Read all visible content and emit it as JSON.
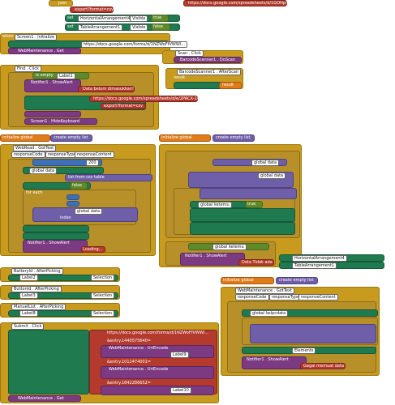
{
  "labels": {
    "json": "json",
    "url_top": "https://docs.google.com/spreadsheets/d/1GOHp/gv...",
    "export_format": "export?format=csv",
    "set": "set",
    "to": "to",
    "when": "when",
    "do": "do",
    "call": "call",
    "if": "if",
    "then": "then",
    "else": "else",
    "result": "result",
    "notice": "notice",
    "text": "text",
    "get": "get",
    "initialize_global": "initialize global",
    "create_empty_list": "create empty list",
    "for_each": "for each",
    "from": "from",
    "by": "by",
    "index": "index",
    "true": "true",
    "false": "false",
    "visible": "Visible",
    "responseCode": "responseCode",
    "responseType": "responseType",
    "responseContent": "responseContent",
    "list_item": "list item",
    "number": "number"
  },
  "blocks": {
    "set_horizontal1": "HorizontalArrangement4",
    "set_table1": "TableArrangement1",
    "screen_init": "Screen1 . Initialize",
    "web_url_1": "https://docs.google.com/forms/d/1NZWoFfVWWl...",
    "web_get": "WebMaintenance . Get",
    "scan_click": "Scan . Click",
    "barcode_do_scan": "BarcodeScanner1 . DoScan",
    "find_click": "Find . Click",
    "is_empty": "is empty",
    "label1": "Label1",
    "notifier_show_alert": "Notifier1 . ShowAlert",
    "data_belum": "Data belum dimasukkan!",
    "barcode_after_scan": "BarcodeScanner1 . AfterScan",
    "url_2": "https://docs.google.com/spreadsheets/d/e/2PACX-1vRk...",
    "export_format_csv": "export?format=csv",
    "get_result": "result",
    "screen_hide_keyboard": "Screen1 . HideKeyboard",
    "init_global_data": "data",
    "web_got_text": "WebRead . GotText",
    "code_200": "200",
    "init_global_ketemu": "ketemu",
    "list_from_csv": "list from csv table",
    "global_data": "global data",
    "loading": "Loading...",
    "ketemu_label": "global ketemu",
    "data_tidak_ada": "Data Tidak ada",
    "init_global_kelpcdata": "kelpcdata",
    "web_got_text_2": "WebMaintenance . GotText",
    "elements": "Elements",
    "global_kelpcdata": "global kelpcdata",
    "gagal_memuat": "Gagal memuat data",
    "batteryid_after_picking": "BatteryId . AfterPicking",
    "buttonid_after_picking": "ButtonId . AfterPicking",
    "manuelist_after_picking": "ManuelList . AfterPicking",
    "submit_click": "Submit . Click",
    "url_submit": "https://docs.google.com/forms/d/1NZWoFfVWWl...",
    "entry_1": "&entry.1440575640=",
    "entry_2": "&entry.1012474001=",
    "entry_3": "&entry.1842286652=",
    "uri_encode": "WebMaintenance . UriEncode",
    "selection": "Selection",
    "label2": "Label2",
    "label3": "Label3",
    "label8": "Label8",
    "label9": "Label9",
    "label10": "Label10"
  },
  "colors": {
    "event": "#c89b1e",
    "set": "#1f7a4f",
    "text": "#b33a2d",
    "list": "#6f5fa8",
    "control": "#b8902a",
    "math": "#3f6fb5",
    "logic": "#5e8a2a",
    "call": "#7c3a83",
    "variable": "#e07b1a"
  }
}
